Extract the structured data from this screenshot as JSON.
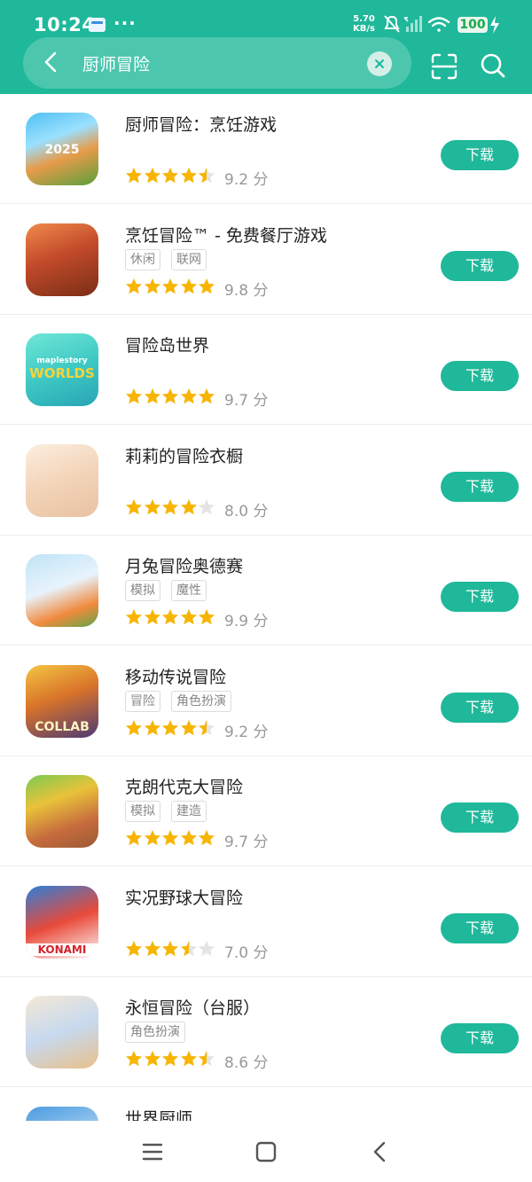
{
  "status_bar": {
    "time": "10:24",
    "speed_value": "5.70",
    "speed_unit": "KB/s",
    "battery": "100",
    "more": "···"
  },
  "search": {
    "value": "厨师冒险"
  },
  "download_label": "下载",
  "score_unit": "分",
  "colors": {
    "accent": "#1fb89a",
    "star": "#f7b500",
    "star_empty": "#e4e4e4"
  },
  "apps": [
    {
      "name": "厨师冒险：烹饪游戏",
      "tags": [],
      "rating": "9.2",
      "stars": 4.5,
      "icon_text": "2025"
    },
    {
      "name": "烹饪冒险™ - 免费餐厅游戏",
      "tags": [
        "休闲",
        "联网"
      ],
      "rating": "9.8",
      "stars": 5,
      "icon_text": ""
    },
    {
      "name": "冒险岛世界",
      "tags": [],
      "rating": "9.7",
      "stars": 5,
      "icon_text": "WORLDS",
      "icon_subtext": "maplestory"
    },
    {
      "name": "莉莉的冒险衣橱",
      "tags": [],
      "rating": "8.0",
      "stars": 4,
      "icon_text": ""
    },
    {
      "name": "月兔冒险奥德赛",
      "tags": [
        "模拟",
        "魔性"
      ],
      "rating": "9.9",
      "stars": 5,
      "icon_text": ""
    },
    {
      "name": "移动传说冒险",
      "tags": [
        "冒险",
        "角色扮演"
      ],
      "rating": "9.2",
      "stars": 4.5,
      "icon_text": "COLLAB"
    },
    {
      "name": "克朗代克大冒险",
      "tags": [
        "模拟",
        "建造"
      ],
      "rating": "9.7",
      "stars": 5,
      "icon_text": ""
    },
    {
      "name": "实况野球大冒险",
      "tags": [],
      "rating": "7.0",
      "stars": 3.5,
      "icon_text": "KONAMI"
    },
    {
      "name": "永恒冒险（台服）",
      "tags": [
        "角色扮演"
      ],
      "rating": "8.6",
      "stars": 4.5,
      "icon_text": ""
    },
    {
      "name": "世界厨师",
      "tags": [],
      "rating": "",
      "stars": 0,
      "icon_text": ""
    }
  ]
}
